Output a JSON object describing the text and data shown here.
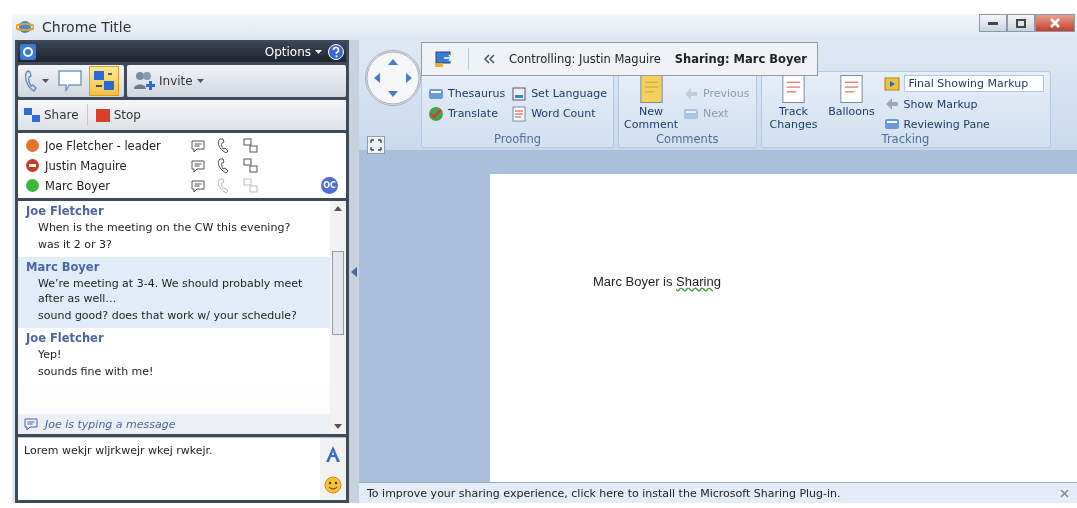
{
  "window": {
    "title": "Chrome Title"
  },
  "meeting": {
    "options_label": "Options",
    "invite_label": "Invite",
    "sharing_selected": true,
    "share_label": "Share",
    "stop_label": "Stop",
    "participants": [
      {
        "name": "Joe Fletcher - leader",
        "color": "#e8742a",
        "kind": "person",
        "audio_available": true
      },
      {
        "name": "Justin Maguire",
        "color": "#c83a2a",
        "kind": "blocked",
        "audio_available": true
      },
      {
        "name": "Marc Boyer",
        "color": "#3cb83c",
        "kind": "person",
        "audio_available": false,
        "badge": "OC"
      }
    ],
    "messages": [
      {
        "sender": "Joe Fletcher",
        "lines": [
          "When is the meeting on the CW this evening?",
          "was it 2 or 3?"
        ],
        "selected": false
      },
      {
        "sender": "Marc Boyer",
        "lines": [
          "We’re meeting at 3-4. We should probably meet after as well…",
          "sound good? does that work w/ your schedule?"
        ],
        "selected": true
      },
      {
        "sender": "Joe Fletcher",
        "lines": [
          "Yep!",
          "sounds fine with me!"
        ],
        "selected": false
      }
    ],
    "typing_notice": "Joe is typing a message",
    "input": {
      "value": "Lorem wekjr wljrkwejr wkej rwkejr."
    }
  },
  "control_bar": {
    "controlling": "Controlling: Justin Maguire",
    "sharing": "Sharing: Marc Boyer"
  },
  "ribbon": {
    "groups": [
      {
        "label": "Proofing",
        "items": [
          {
            "kind": "small",
            "label": "Thesaurus",
            "disabled": false
          },
          {
            "kind": "small",
            "label": "Translate",
            "disabled": false
          },
          {
            "kind": "small",
            "label": "Set Language",
            "disabled": false
          },
          {
            "kind": "small",
            "label": "Word Count",
            "disabled": false
          }
        ]
      },
      {
        "label": "Comments",
        "items": [
          {
            "kind": "large",
            "label": "New Comment",
            "disabled": false
          },
          {
            "kind": "small",
            "label": "Previous",
            "disabled": true
          },
          {
            "kind": "small",
            "label": "Next",
            "disabled": true
          }
        ]
      },
      {
        "label": "Tracking",
        "items": [
          {
            "kind": "large",
            "label": "Track Changes",
            "disabled": false
          },
          {
            "kind": "large",
            "label": "Balloons",
            "disabled": false
          },
          {
            "kind": "field",
            "label": "Final Showing Markup",
            "disabled": false
          },
          {
            "kind": "small",
            "label": "Show Markup",
            "disabled": false
          },
          {
            "kind": "small",
            "label": "Reviewing Pane",
            "disabled": false
          }
        ]
      }
    ]
  },
  "document": {
    "text": "Marc Boyer is",
    "flagged_word": "Sharing"
  },
  "status_bar": {
    "message": "To improve your sharing experience, click here to install the Microsoft Sharing Plug-in."
  }
}
